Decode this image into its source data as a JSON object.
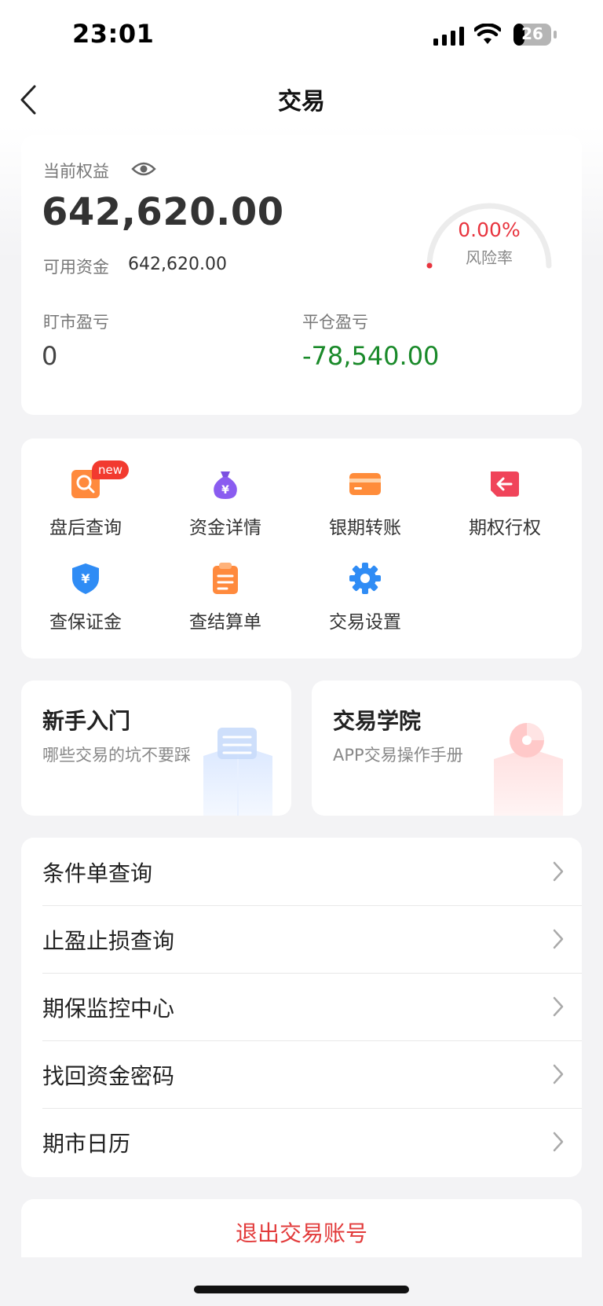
{
  "status_bar": {
    "time": "23:01",
    "battery": "26"
  },
  "nav": {
    "title": "交易"
  },
  "equity": {
    "label": "当前权益",
    "value": "642,620.00",
    "available_label": "可用资金",
    "available_value": "642,620.00",
    "risk_value": "0.00%",
    "risk_label": "风险率",
    "risk_fraction": 0.0,
    "mtm_label": "盯市盈亏",
    "mtm_value": "0",
    "close_label": "平仓盈亏",
    "close_value": "-78,540.00"
  },
  "grid": {
    "items": [
      {
        "label": "盘后查询",
        "icon": "search-doc-icon",
        "badge": "new"
      },
      {
        "label": "资金详情",
        "icon": "money-bag-icon"
      },
      {
        "label": "银期转账",
        "icon": "card-icon"
      },
      {
        "label": "期权行权",
        "icon": "exercise-arrow-icon"
      },
      {
        "label": "查保证金",
        "icon": "shield-yen-icon"
      },
      {
        "label": "查结算单",
        "icon": "clipboard-icon"
      },
      {
        "label": "交易设置",
        "icon": "gear-icon"
      }
    ]
  },
  "promos": [
    {
      "title": "新手入门",
      "subtitle": "哪些交易的坑不要踩"
    },
    {
      "title": "交易学院",
      "subtitle": "APP交易操作手册"
    }
  ],
  "menu": {
    "items": [
      {
        "label": "条件单查询"
      },
      {
        "label": "止盈止损查询"
      },
      {
        "label": "期保监控中心"
      },
      {
        "label": "找回资金密码"
      },
      {
        "label": "期市日历"
      }
    ]
  },
  "logout": {
    "label": "退出交易账号"
  },
  "colors": {
    "accent_red": "#e23b3b",
    "profit_green": "#1a8a2a",
    "background": "#f3f3f5"
  }
}
